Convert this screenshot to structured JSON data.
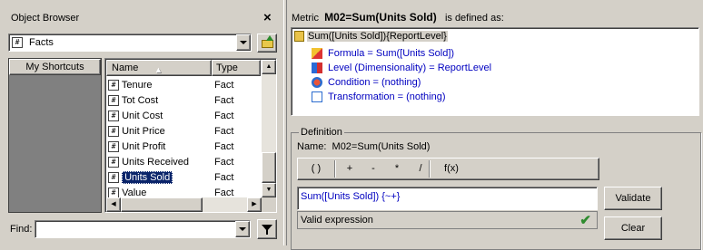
{
  "object_browser": {
    "title": "Object Browser",
    "close_glyph": "×",
    "folder_icon_text": "#",
    "folder_value": "Facts",
    "shortcuts_label": "My Shortcuts",
    "columns": {
      "name": "Name",
      "type": "Type"
    },
    "rows": [
      {
        "name": "Tenure",
        "type": "Fact"
      },
      {
        "name": "Tot Cost",
        "type": "Fact"
      },
      {
        "name": "Unit Cost",
        "type": "Fact"
      },
      {
        "name": "Unit Price",
        "type": "Fact"
      },
      {
        "name": "Unit Profit",
        "type": "Fact"
      },
      {
        "name": "Units Received",
        "type": "Fact"
      },
      {
        "name": "Units Sold",
        "type": "Fact",
        "selected": true
      },
      {
        "name": "Value",
        "type": "Fact"
      }
    ],
    "find_label": "Find:",
    "find_value": ""
  },
  "metric": {
    "header_prefix": "Metric",
    "name": "M02=Sum(Units Sold)",
    "header_suffix": "is defined as:",
    "tree_root": "Sum([Units Sold]){ReportLevel}",
    "tree_items": [
      {
        "icon": "formula-icon",
        "label": "Formula = Sum([Units Sold])"
      },
      {
        "icon": "level-icon",
        "label": "Level (Dimensionality) = ReportLevel"
      },
      {
        "icon": "condition-icon",
        "label": "Condition = (nothing)"
      },
      {
        "icon": "transformation-icon",
        "label": "Transformation = (nothing)"
      }
    ]
  },
  "definition": {
    "group_label": "Definition",
    "name_label": "Name:",
    "name_value": "M02=Sum(Units Sold)",
    "operators": [
      "( )",
      "+",
      "-",
      "*",
      "/",
      "f(x)"
    ],
    "expression": "Sum([Units Sold]) {~+}",
    "status": "Valid expression",
    "validate_label": "Validate",
    "clear_label": "Clear"
  },
  "colors": {
    "link_blue": "#0000c0",
    "selection": "#0a246a",
    "valid_check": "#2e8b2e"
  }
}
